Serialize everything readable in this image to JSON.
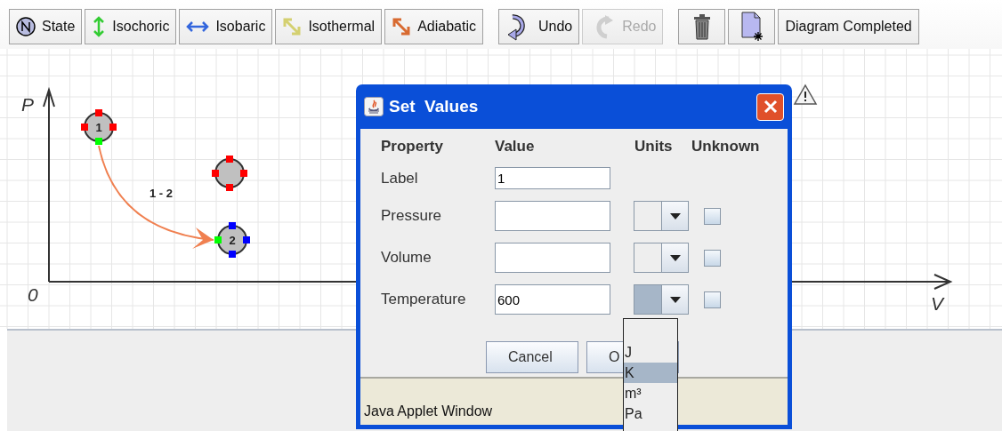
{
  "toolbar": {
    "tools": [
      {
        "kind": "state",
        "label": "State"
      },
      {
        "kind": "isochoric",
        "label": "Isochoric"
      },
      {
        "kind": "isobaric",
        "label": "Isobaric"
      },
      {
        "kind": "isothermal",
        "label": "Isothermal"
      },
      {
        "kind": "adiabatic",
        "label": "Adiabatic"
      }
    ],
    "history": [
      {
        "kind": "undo",
        "label": "Undo",
        "disabled": false
      },
      {
        "kind": "redo",
        "label": "Redo",
        "disabled": true
      }
    ],
    "actions": [
      {
        "kind": "delete"
      },
      {
        "kind": "new"
      }
    ],
    "finish": "Diagram Completed"
  },
  "diagram": {
    "y_axis": "P",
    "origin": "0",
    "x_axis": "V",
    "states": [
      {
        "label": "1",
        "color": "#ff0000"
      },
      {
        "color": "#ff0000"
      },
      {
        "label": "2",
        "color": "#0000ff"
      }
    ],
    "processes": [
      {
        "label": "1 - 2",
        "kind": "adiabatic"
      }
    ],
    "warning": true
  },
  "dialog": {
    "title": "Set  Values",
    "columns": [
      "Property",
      "Value",
      "Units",
      "Unknown"
    ],
    "rows": [
      {
        "kind": "text",
        "property": "Label",
        "value": "1"
      },
      {
        "kind": "quantity",
        "property": "Pressure",
        "unknown": false,
        "open": false
      },
      {
        "kind": "quantity",
        "property": "Volume",
        "unknown": false,
        "open": false
      },
      {
        "kind": "quantity",
        "property": "Temperature",
        "value": "600",
        "unknown": false,
        "open": true
      }
    ],
    "unit_list": [
      {
        "label": "J",
        "selected": false
      },
      {
        "label": "K",
        "selected": true
      },
      {
        "label": "m³",
        "selected": false
      },
      {
        "label": "Pa",
        "selected": false
      }
    ],
    "buttons": [
      "Cancel",
      "O"
    ],
    "status": "Java Applet Window"
  }
}
